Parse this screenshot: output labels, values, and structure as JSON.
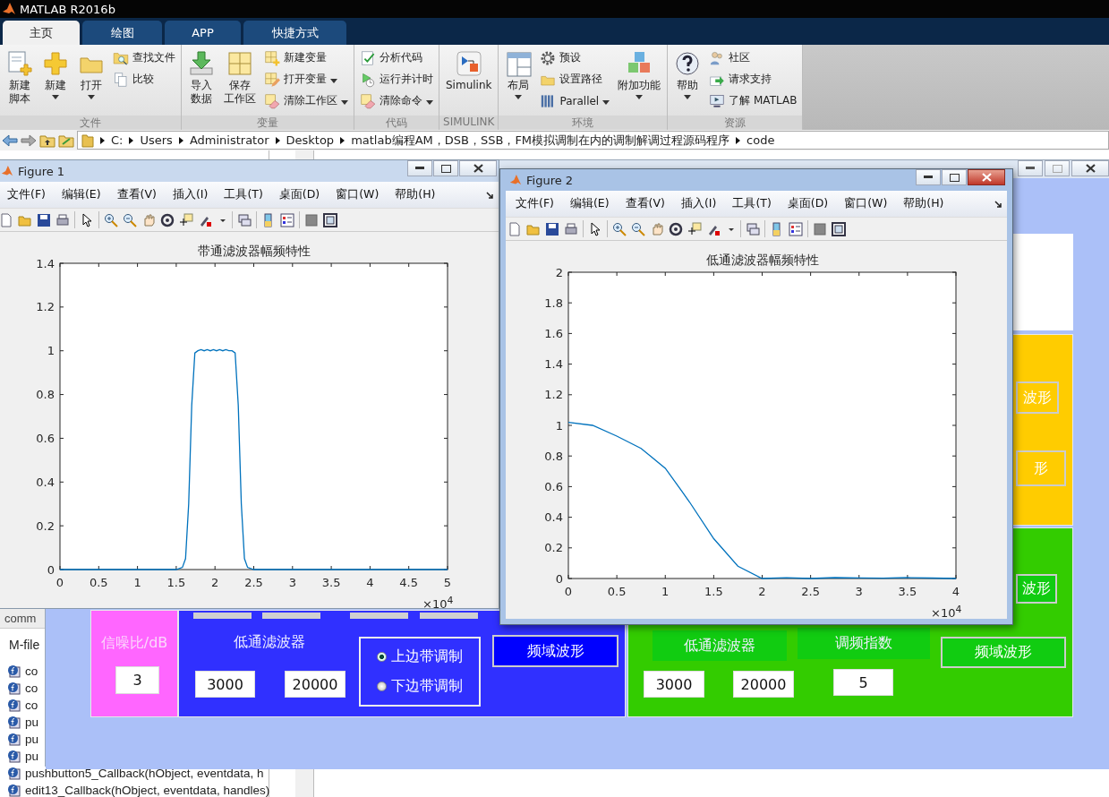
{
  "window": {
    "title": "MATLAB R2016b"
  },
  "ribbon_tabs": [
    {
      "label": "主页",
      "selected": true
    },
    {
      "label": "绘图",
      "selected": false
    },
    {
      "label": "APP",
      "selected": false
    },
    {
      "label": "快捷方式",
      "selected": false
    }
  ],
  "ribbon_groups": [
    {
      "title": "文件",
      "columns": [
        {
          "kind": "large",
          "lines": [
            "新建",
            "脚本"
          ],
          "dropdown": false
        },
        {
          "kind": "large",
          "lines": [
            "新建"
          ],
          "dropdown": true
        },
        {
          "kind": "large",
          "lines": [
            "打开"
          ],
          "dropdown": true
        },
        {
          "kind": "stack",
          "items": [
            {
              "label": "查找文件",
              "dropdown": false
            },
            {
              "label": "比较",
              "dropdown": false
            }
          ]
        }
      ]
    },
    {
      "title": "变量",
      "columns": [
        {
          "kind": "large",
          "lines": [
            "导入",
            "数据"
          ],
          "dropdown": false
        },
        {
          "kind": "large",
          "lines": [
            "保存",
            "工作区"
          ],
          "dropdown": false
        },
        {
          "kind": "stack",
          "items": [
            {
              "label": "新建变量",
              "dropdown": false
            },
            {
              "label": "打开变量",
              "dropdown": true
            },
            {
              "label": "清除工作区",
              "dropdown": true
            }
          ]
        }
      ]
    },
    {
      "title": "代码",
      "columns": [
        {
          "kind": "stack",
          "items": [
            {
              "label": "分析代码",
              "dropdown": false
            },
            {
              "label": "运行并计时",
              "dropdown": false
            },
            {
              "label": "清除命令",
              "dropdown": true
            }
          ]
        }
      ]
    },
    {
      "title": "SIMULINK",
      "columns": [
        {
          "kind": "large",
          "lines": [
            "Simulink"
          ],
          "dropdown": false
        }
      ]
    },
    {
      "title": "环境",
      "columns": [
        {
          "kind": "large",
          "lines": [
            "布局"
          ],
          "dropdown": true
        },
        {
          "kind": "stack",
          "items": [
            {
              "label": "预设",
              "dropdown": false
            },
            {
              "label": "设置路径",
              "dropdown": false
            },
            {
              "label": "Parallel",
              "dropdown": true
            }
          ]
        },
        {
          "kind": "large",
          "lines": [
            "附加功能"
          ],
          "dropdown": true
        }
      ]
    },
    {
      "title": "资源",
      "columns": [
        {
          "kind": "large",
          "lines": [
            "帮助"
          ],
          "dropdown": true
        },
        {
          "kind": "stack",
          "items": [
            {
              "label": "社区",
              "dropdown": false
            },
            {
              "label": "请求支持",
              "dropdown": false
            },
            {
              "label": "了解 MATLAB",
              "dropdown": false
            }
          ]
        }
      ]
    }
  ],
  "address_bar": {
    "crumbs": [
      "C:",
      "Users",
      "Administrator",
      "Desktop",
      "matlab编程AM，DSB，SSB，FM模拟调制在内的调制解调过程源码程序",
      "code"
    ]
  },
  "file_panel": {
    "header": "comm",
    "section": "M-file",
    "items": [
      "co",
      "co",
      "co",
      "pu",
      "pu",
      "pu",
      "pushbutton5_Callback(hObject, eventdata, h",
      "edit13_Callback(hObject, eventdata, handles)"
    ]
  },
  "gui_window": {
    "snr_panel": {
      "label": "信噪比/dB",
      "value": "3"
    },
    "ssb_panel": {
      "filter_label": "低通滤波器",
      "cutoffs": [
        "3000",
        "20000"
      ],
      "radios": [
        {
          "label": "上边带调制",
          "selected": true
        },
        {
          "label": "下边带调制",
          "selected": false
        }
      ],
      "button": "频域波形"
    },
    "yellow_panel": {
      "buttons": [
        "波形",
        "形"
      ]
    },
    "fm_panel": {
      "side_button": "波形",
      "filter_label": "低通滤波器",
      "index_label": "调频指数",
      "button": "频域波形",
      "cutoffs": [
        "3000",
        "20000"
      ],
      "index": "5"
    }
  },
  "figures": [
    {
      "title": "Figure 1",
      "active": false,
      "menus": [
        "文件(F)",
        "编辑(E)",
        "查看(V)",
        "插入(I)",
        "工具(T)",
        "桌面(D)",
        "窗口(W)",
        "帮助(H)"
      ],
      "x_multiplier": "×10$^{4}$",
      "chart_data": {
        "type": "line",
        "title": "带通滤波器幅频特性",
        "xlim": [
          0,
          5
        ],
        "ylim": [
          0,
          1.4
        ],
        "xticks": [
          0,
          0.5,
          1,
          1.5,
          2,
          2.5,
          3,
          3.5,
          4,
          4.5,
          5
        ],
        "yticks": [
          0,
          0.2,
          0.4,
          0.6,
          0.8,
          1,
          1.2,
          1.4
        ],
        "x": [
          0,
          1.5,
          1.58,
          1.62,
          1.66,
          1.7,
          1.74,
          1.78,
          1.82,
          1.86,
          1.9,
          1.94,
          1.98,
          2.02,
          2.06,
          2.1,
          2.14,
          2.18,
          2.22,
          2.26,
          2.3,
          2.34,
          2.38,
          2.42,
          2.5,
          3,
          4,
          5
        ],
        "series": [
          {
            "color": "#0072bd",
            "values": [
              0,
              0,
              0.01,
              0.05,
              0.3,
              0.75,
              0.99,
              1,
              1.005,
              1,
              1.005,
              1,
              1.005,
              1,
              1.005,
              1,
              1.005,
              1,
              1,
              0.99,
              0.75,
              0.3,
              0.05,
              0.01,
              0,
              0,
              0,
              0
            ]
          }
        ]
      }
    },
    {
      "title": "Figure 2",
      "active": true,
      "menus": [
        "文件(F)",
        "编辑(E)",
        "查看(V)",
        "插入(I)",
        "工具(T)",
        "桌面(D)",
        "窗口(W)",
        "帮助(H)"
      ],
      "x_multiplier": "×10$^{4}$",
      "chart_data": {
        "type": "line",
        "title": "低通滤波器幅频特性",
        "xlim": [
          0,
          4
        ],
        "ylim": [
          0,
          2
        ],
        "xticks": [
          0,
          0.5,
          1,
          1.5,
          2,
          2.5,
          3,
          3.5,
          4
        ],
        "yticks": [
          0,
          0.2,
          0.4,
          0.6,
          0.8,
          1,
          1.2,
          1.4,
          1.6,
          1.8,
          2
        ],
        "x": [
          0,
          0.25,
          0.5,
          0.75,
          1,
          1.25,
          1.5,
          1.75,
          2,
          2.25,
          2.5,
          2.75,
          3,
          3.25,
          3.5,
          3.75,
          4
        ],
        "series": [
          {
            "color": "#0072bd",
            "values": [
              1.02,
              1,
              0.93,
              0.85,
              0.72,
              0.5,
              0.26,
              0.08,
              0,
              0.005,
              0,
              0.006,
              0.004,
              0.002,
              0.006,
              0.003,
              0
            ]
          }
        ]
      }
    }
  ]
}
